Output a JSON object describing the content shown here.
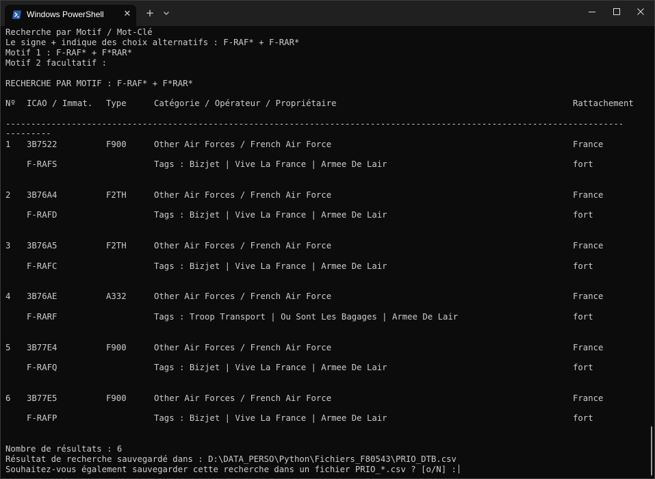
{
  "window": {
    "tab_title": "Windows PowerShell",
    "tab_close": "✕",
    "new_tab": "+",
    "colors": {
      "terminal_bg": "#0c0c0c",
      "titlebar_bg": "#202020",
      "text": "#cccccc",
      "ps_icon": "#2b5fb3"
    }
  },
  "intro": [
    "Recherche par Motif / Mot-Clé",
    "Le signe + indique des choix alternatifs : F-RAF* + F-RAR*",
    "Motif 1 : F-RAF* + F*RAR*",
    "Motif 2 facultatif :"
  ],
  "search_heading": "RECHERCHE PAR MOTIF : F-RAF* + F*RAR*",
  "table": {
    "headers": {
      "no": "Nº",
      "icao": "ICAO / Immat.",
      "type": "Type",
      "category": "Catégorie / Opérateur / Propriétaire",
      "rattachement": "Rattachement"
    },
    "separator_1": "--------------------------------------------------------------------------------------------------------------------------",
    "separator_2": "---------",
    "rows": [
      {
        "no": "1",
        "icao": "3B7522",
        "type": "F900",
        "category": "Other Air Forces / French Air Force",
        "rattachement": "France",
        "immat": "F-RAFS",
        "tags": "Tags : Bizjet | Vive La France | Armee De Lair",
        "rattachement2": "fort"
      },
      {
        "no": "2",
        "icao": "3B76A4",
        "type": "F2TH",
        "category": "Other Air Forces / French Air Force",
        "rattachement": "France",
        "immat": "F-RAFD",
        "tags": "Tags : Bizjet | Vive La France | Armee De Lair",
        "rattachement2": "fort"
      },
      {
        "no": "3",
        "icao": "3B76A5",
        "type": "F2TH",
        "category": "Other Air Forces / French Air Force",
        "rattachement": "France",
        "immat": "F-RAFC",
        "tags": "Tags : Bizjet | Vive La France | Armee De Lair",
        "rattachement2": "fort"
      },
      {
        "no": "4",
        "icao": "3B76AE",
        "type": "A332",
        "category": "Other Air Forces / French Air Force",
        "rattachement": "France",
        "immat": "F-RARF",
        "tags": "Tags : Troop Transport | Ou Sont Les Bagages | Armee De Lair",
        "rattachement2": "fort"
      },
      {
        "no": "5",
        "icao": "3B77E4",
        "type": "F900",
        "category": "Other Air Forces / French Air Force",
        "rattachement": "France",
        "immat": "F-RAFQ",
        "tags": "Tags : Bizjet | Vive La France | Armee De Lair",
        "rattachement2": "fort"
      },
      {
        "no": "6",
        "icao": "3B77E5",
        "type": "F900",
        "category": "Other Air Forces / French Air Force",
        "rattachement": "France",
        "immat": "F-RAFP",
        "tags": "Tags : Bizjet | Vive La France | Armee De Lair",
        "rattachement2": "fort"
      }
    ]
  },
  "footer": {
    "count": "Nombre de résultats : 6",
    "saved": "Résultat de recherche sauvegardé dans : D:\\DATA_PERSO\\Python\\Fichiers_F80543\\PRIO_DTB.csv",
    "prompt": "Souhaitez-vous également sauvegarder cette recherche dans un fichier PRIO_*.csv ? [o/N] :"
  }
}
